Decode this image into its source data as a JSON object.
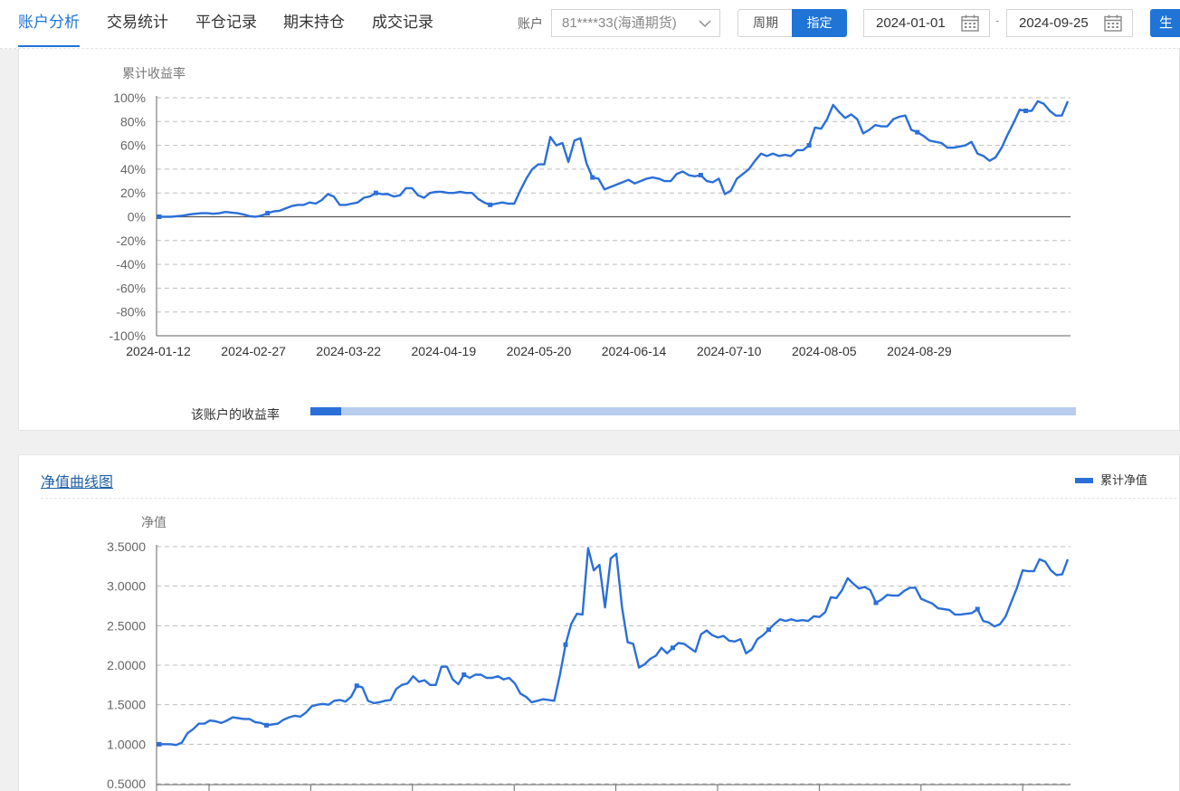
{
  "nav": {
    "tabs": [
      {
        "label": "账户分析",
        "active": true
      },
      {
        "label": "交易统计",
        "active": false
      },
      {
        "label": "平仓记录",
        "active": false
      },
      {
        "label": "期末持仓",
        "active": false
      },
      {
        "label": "成交记录",
        "active": false
      }
    ],
    "account_label": "账户",
    "account_value": "81****33(海通期货)",
    "period_off": "周期",
    "period_on": "指定",
    "date_start": "2024-01-01",
    "date_sep": "-",
    "date_end": "2024-09-25",
    "generate_button": "生"
  },
  "colors": {
    "accent": "#1f74d6",
    "line": "#2b6fd8",
    "progress_track": "#b9cdef"
  },
  "return_panel": {
    "progress_label": "该账户的收益率",
    "progress_fraction": 0.04,
    "chart_data": {
      "type": "line",
      "ylabel": "累计收益率",
      "ylim": [
        -100,
        100
      ],
      "y_ticks": [
        "100%",
        "80%",
        "60%",
        "40%",
        "20%",
        "0%",
        "-20%",
        "-40%",
        "-60%",
        "-80%",
        "-100%"
      ],
      "x_tick_labels": [
        "2024-01-12",
        "2024-02-27",
        "2024-03-22",
        "2024-04-19",
        "2024-05-20",
        "2024-06-14",
        "2024-07-10",
        "2024-08-05",
        "2024-08-29"
      ],
      "grid": true,
      "series": [
        {
          "values": [
            0,
            0,
            0,
            0.5,
            1,
            2,
            2.5,
            3,
            3,
            2.5,
            3,
            4,
            3.5,
            3,
            2,
            0.5,
            0,
            1,
            3,
            4.5,
            5,
            7,
            9,
            10,
            10,
            12,
            11,
            14,
            19,
            17,
            10,
            10,
            11,
            12,
            16,
            17,
            20,
            19,
            19,
            17,
            18,
            24,
            24,
            18,
            16,
            20,
            21,
            21,
            20,
            20,
            21,
            20,
            20,
            15,
            12,
            10,
            11,
            12,
            11,
            11,
            22,
            32,
            40,
            44,
            44,
            67,
            60,
            62,
            46,
            64,
            66,
            45,
            33,
            32,
            23,
            25,
            27,
            29,
            31,
            28,
            30,
            32,
            33,
            32,
            30,
            30,
            36,
            38,
            35,
            34,
            35,
            30,
            29,
            32,
            19,
            22,
            32,
            36,
            40,
            47,
            53,
            51,
            53,
            51,
            52,
            51,
            56,
            56,
            60,
            75,
            74,
            82,
            94,
            88,
            83,
            86,
            82,
            70,
            73,
            77,
            76,
            76,
            82,
            84,
            85,
            73,
            71,
            68,
            64,
            63,
            62,
            58,
            58,
            59,
            60,
            63,
            53,
            51,
            47,
            50,
            58,
            69,
            79,
            90,
            89,
            89,
            97,
            95,
            89,
            85,
            85,
            97
          ]
        }
      ]
    }
  },
  "nav_panel": {
    "title": "净值曲线图",
    "legend_label": "累计净值",
    "chart_data": {
      "type": "line",
      "ylabel": "净值",
      "ylim": [
        0.5,
        3.5
      ],
      "y_ticks": [
        "3.5000",
        "3.0000",
        "2.5000",
        "2.0000",
        "1.5000",
        "1.0000",
        "0.5000"
      ],
      "grid": true,
      "series": [
        {
          "name": "累计净值",
          "values": [
            1.0,
            1.0,
            1.0,
            0.99,
            1.02,
            1.14,
            1.19,
            1.26,
            1.26,
            1.3,
            1.29,
            1.27,
            1.3,
            1.34,
            1.33,
            1.32,
            1.32,
            1.28,
            1.27,
            1.24,
            1.25,
            1.26,
            1.31,
            1.34,
            1.36,
            1.35,
            1.4,
            1.48,
            1.5,
            1.51,
            1.5,
            1.55,
            1.56,
            1.54,
            1.6,
            1.74,
            1.72,
            1.55,
            1.52,
            1.53,
            1.55,
            1.56,
            1.7,
            1.75,
            1.77,
            1.86,
            1.79,
            1.81,
            1.75,
            1.75,
            1.98,
            1.98,
            1.82,
            1.76,
            1.88,
            1.84,
            1.88,
            1.88,
            1.84,
            1.84,
            1.86,
            1.82,
            1.84,
            1.77,
            1.64,
            1.6,
            1.53,
            1.55,
            1.57,
            1.56,
            1.55,
            1.88,
            2.26,
            2.52,
            2.65,
            2.64,
            3.48,
            3.2,
            3.27,
            2.73,
            3.35,
            3.41,
            2.73,
            2.29,
            2.27,
            1.97,
            2.01,
            2.08,
            2.12,
            2.22,
            2.15,
            2.22,
            2.28,
            2.27,
            2.22,
            2.17,
            2.39,
            2.44,
            2.38,
            2.35,
            2.37,
            2.31,
            2.3,
            2.33,
            2.15,
            2.2,
            2.33,
            2.38,
            2.45,
            2.52,
            2.58,
            2.56,
            2.58,
            2.56,
            2.57,
            2.56,
            2.62,
            2.61,
            2.67,
            2.86,
            2.85,
            2.95,
            3.1,
            3.03,
            2.97,
            2.99,
            2.95,
            2.79,
            2.83,
            2.89,
            2.88,
            2.88,
            2.94,
            2.98,
            2.98,
            2.84,
            2.81,
            2.78,
            2.72,
            2.71,
            2.7,
            2.64,
            2.64,
            2.65,
            2.66,
            2.71,
            2.56,
            2.54,
            2.49,
            2.52,
            2.62,
            2.8,
            2.98,
            3.2,
            3.19,
            3.19,
            3.34,
            3.31,
            3.2,
            3.14,
            3.15,
            3.34
          ]
        }
      ]
    }
  }
}
